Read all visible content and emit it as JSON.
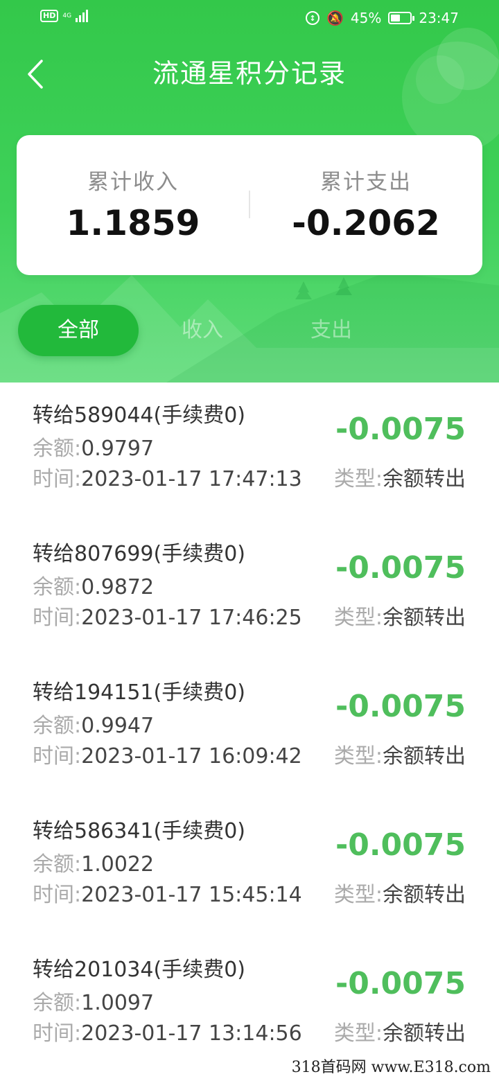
{
  "status_bar": {
    "hd": "HD",
    "network": "4G",
    "battery": "45%",
    "time": "23:47"
  },
  "header": {
    "title": "流通星积分记录"
  },
  "summary": {
    "income_label": "累计收入",
    "income_value": "1.1859",
    "expense_label": "累计支出",
    "expense_value": "-0.2062"
  },
  "tabs": [
    {
      "label": "全部",
      "active": true
    },
    {
      "label": "收入",
      "active": false
    },
    {
      "label": "支出",
      "active": false
    }
  ],
  "records": [
    {
      "title": "转给589044(手续费0)",
      "balance_label": "余额:",
      "balance": "0.9797",
      "time_label": "时间:",
      "time": "2023-01-17 17:47:13",
      "amount": "-0.0075",
      "type_label": "类型:",
      "type": "余额转出"
    },
    {
      "title": "转给807699(手续费0)",
      "balance_label": "余额:",
      "balance": "0.9872",
      "time_label": "时间:",
      "time": "2023-01-17 17:46:25",
      "amount": "-0.0075",
      "type_label": "类型:",
      "type": "余额转出"
    },
    {
      "title": "转给194151(手续费0)",
      "balance_label": "余额:",
      "balance": "0.9947",
      "time_label": "时间:",
      "time": "2023-01-17 16:09:42",
      "amount": "-0.0075",
      "type_label": "类型:",
      "type": "余额转出"
    },
    {
      "title": "转给586341(手续费0)",
      "balance_label": "余额:",
      "balance": "1.0022",
      "time_label": "时间:",
      "time": "2023-01-17 15:45:14",
      "amount": "-0.0075",
      "type_label": "类型:",
      "type": "余额转出"
    },
    {
      "title": "转给201034(手续费0)",
      "balance_label": "余额:",
      "balance": "1.0097",
      "time_label": "时间:",
      "time": "2023-01-17 13:14:56",
      "amount": "-0.0075",
      "type_label": "类型:",
      "type": "余额转出"
    }
  ],
  "watermark": "318首码网 www.E318.com",
  "colors": {
    "header_green": "#3fd15a",
    "tab_active": "#22b93b",
    "amount_green": "#4fbe5c"
  }
}
